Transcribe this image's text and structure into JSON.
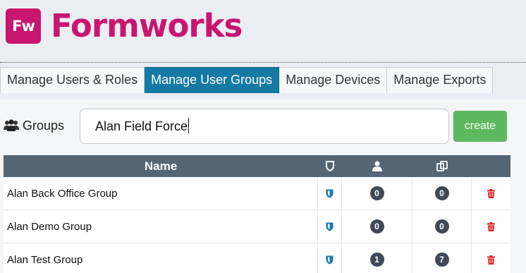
{
  "brand": {
    "logo_mark": "Fw",
    "name": "Formworks",
    "color": "#c8166f"
  },
  "tabs": [
    {
      "label": "Manage Users & Roles",
      "active": false
    },
    {
      "label": "Manage User Groups",
      "active": true
    },
    {
      "label": "Manage Devices",
      "active": false
    },
    {
      "label": "Manage Exports",
      "active": false
    }
  ],
  "groups": {
    "label": "Groups",
    "icon": "users-icon",
    "search_value": "Alan Field Force",
    "create_label": "create"
  },
  "table": {
    "columns": {
      "name": "Name",
      "shield_icon": "shield-icon",
      "user_icon": "user-icon",
      "devices_icon": "devices-icon"
    },
    "rows": [
      {
        "name": "Alan Back Office Group",
        "users": "0",
        "devices": "0"
      },
      {
        "name": "Alan Demo Group",
        "users": "0",
        "devices": "0"
      },
      {
        "name": "Alan Test Group",
        "users": "1",
        "devices": "7"
      }
    ]
  },
  "colors": {
    "active_tab": "#147aa3",
    "header_row": "#566574",
    "create_button": "#5cb85c",
    "delete_icon": "#e02020",
    "shield": "#1f7ab0"
  }
}
